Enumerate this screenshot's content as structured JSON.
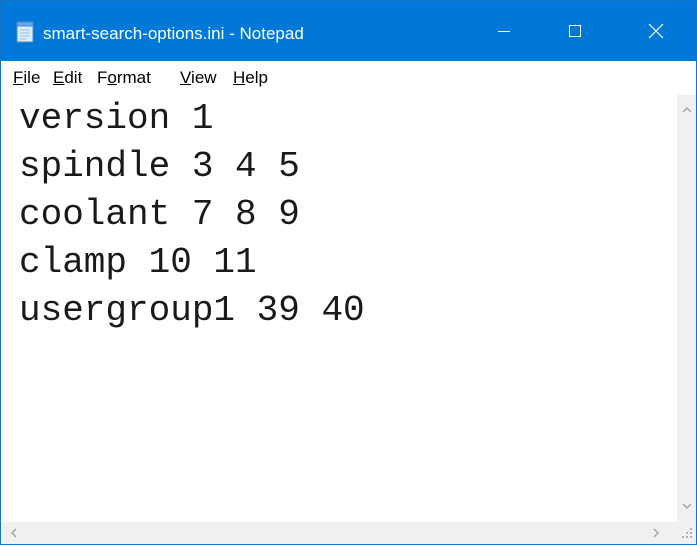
{
  "window": {
    "title": "smart-search-options.ini - Notepad",
    "accent_color": "#0078d7"
  },
  "titlebar": {
    "icon": "notepad-icon",
    "buttons": [
      {
        "name": "minimize",
        "icon": "minimize-icon"
      },
      {
        "name": "maximize",
        "icon": "maximize-icon"
      },
      {
        "name": "close",
        "icon": "close-icon"
      }
    ]
  },
  "menu": {
    "items": [
      {
        "label": "File",
        "mnemonic": "F"
      },
      {
        "label": "Edit",
        "mnemonic": "E"
      },
      {
        "label": "Format",
        "mnemonic": "o"
      },
      {
        "label": "View",
        "mnemonic": "V"
      },
      {
        "label": "Help",
        "mnemonic": "H"
      }
    ]
  },
  "editor": {
    "lines": [
      "version 1",
      "spindle 3 4 5",
      "coolant 7 8 9",
      "clamp 10 11",
      "usergroup1 39 40"
    ]
  },
  "scrollbars": {
    "vertical": {
      "up_icon": "chevron-up-icon",
      "down_icon": "chevron-down-icon"
    },
    "horizontal": {
      "left_icon": "chevron-left-icon",
      "right_icon": "chevron-right-icon"
    },
    "corner_icon": "size-grip-icon"
  }
}
